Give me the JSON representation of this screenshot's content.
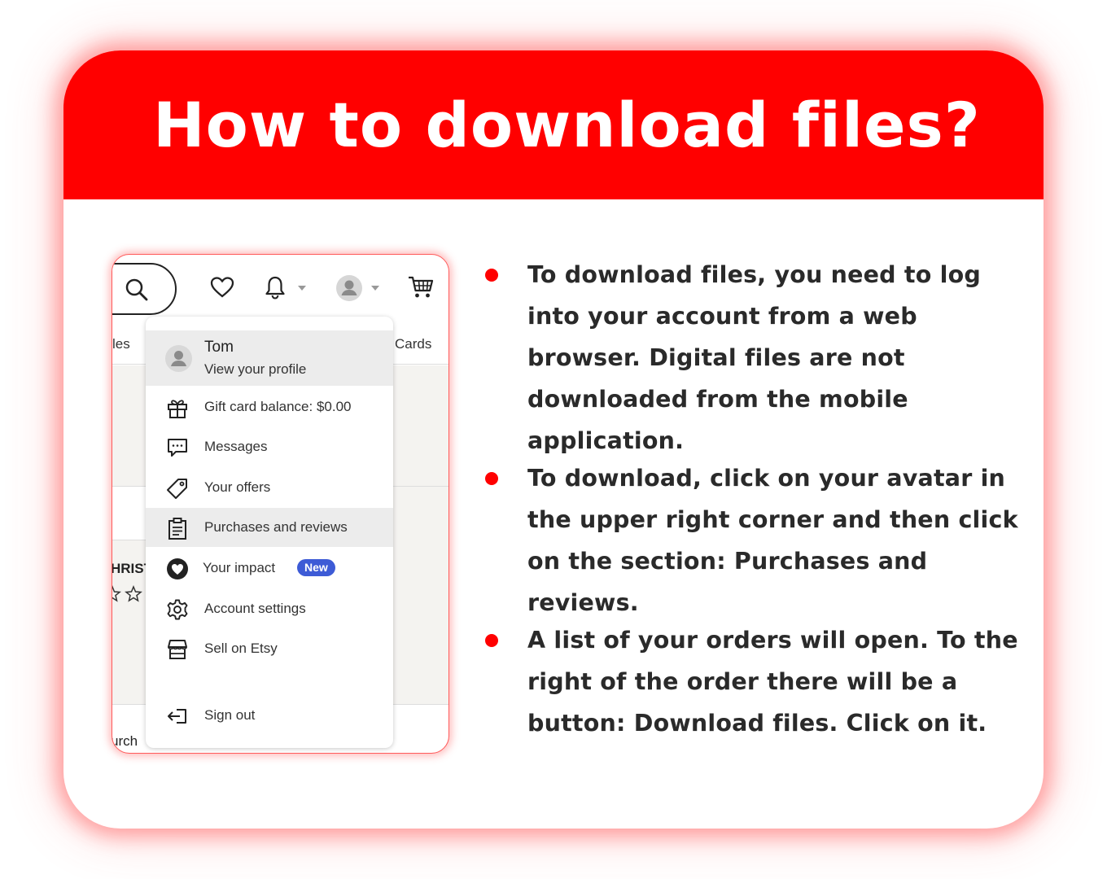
{
  "header": {
    "title": "How to download files?"
  },
  "colors": {
    "accent": "#ff0000",
    "badge": "#3d5bd6"
  },
  "screenshot": {
    "nav_fragment_left": "les",
    "nav_fragment_right": "Cards",
    "bg_fragment_1": "HRIST",
    "bg_fragment_2": "urch",
    "icons": [
      "search-icon",
      "heart-icon",
      "bell-icon",
      "avatar-icon",
      "cart-icon"
    ],
    "profile": {
      "name": "Tom",
      "subtitle": "View your profile"
    },
    "menu": [
      {
        "label": "Gift card balance: $0.00",
        "icon": "gift-icon"
      },
      {
        "label": "Messages",
        "icon": "message-icon"
      },
      {
        "label": "Your offers",
        "icon": "tag-icon"
      },
      {
        "label": "Purchases and reviews",
        "icon": "clipboard-icon",
        "highlighted": true
      },
      {
        "label": "Your impact",
        "icon": "heart-circle-icon",
        "badge": "New"
      },
      {
        "label": "Account settings",
        "icon": "gear-icon"
      },
      {
        "label": "Sell on Etsy",
        "icon": "shop-icon"
      },
      {
        "label": "Sign out",
        "icon": "sign-out-icon"
      }
    ]
  },
  "bullets": [
    "To download files, you need to log into your account from a web browser. Digital files are not downloaded from the mobile application.",
    "To download, click on your avatar in the upper right corner and then click on the section: Purchases and reviews.",
    "A list of your orders will open. To the right of the order there will be a button: Download files. Click on it."
  ]
}
